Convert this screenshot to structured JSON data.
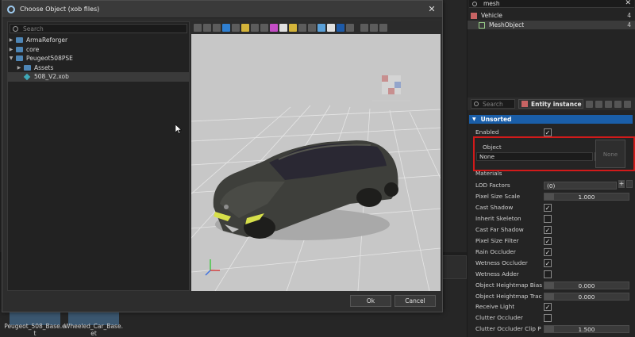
{
  "dialog": {
    "title": "Choose Object (xob files)",
    "search_placeholder": "Search",
    "tree": [
      {
        "label": "ArmaReforger",
        "type": "folder",
        "level": 0,
        "expanded": false
      },
      {
        "label": "core",
        "type": "folder",
        "level": 0,
        "expanded": false
      },
      {
        "label": "Peugeot508PSE",
        "type": "folder",
        "level": 0,
        "expanded": true
      },
      {
        "label": "Assets",
        "type": "folder",
        "level": 1,
        "expanded": false
      },
      {
        "label": "508_V2.xob",
        "type": "xob-file",
        "level": 1,
        "selected": true
      }
    ],
    "ok_label": "Ok",
    "cancel_label": "Cancel"
  },
  "assets": [
    {
      "label_line1": "Peugeot_508_Base.e",
      "label_line2": "t"
    },
    {
      "label_line1": "Wheeled_Car_Base.",
      "label_line2": "et"
    }
  ],
  "hierarchy": {
    "search_value": "mesh",
    "rows": [
      {
        "label": "Vehicle",
        "count": "4"
      },
      {
        "label": "MeshObject",
        "count": "4"
      }
    ]
  },
  "inspector": {
    "search_placeholder": "Search",
    "entity_label": "Entity instance",
    "section": "Unsorted",
    "enabled_label": "Enabled",
    "object_label": "Object",
    "object_value": "None",
    "object_preview": "None",
    "materials_label": "Materials",
    "props": [
      {
        "label": "LOD Factors",
        "kind": "list",
        "value": "(0)"
      },
      {
        "label": "Pixel Size Scale",
        "kind": "number",
        "value": "1.000"
      },
      {
        "label": "Cast Shadow",
        "kind": "check",
        "checked": true
      },
      {
        "label": "Inherit Skeleton",
        "kind": "check",
        "checked": false
      },
      {
        "label": "Cast Far Shadow",
        "kind": "check",
        "checked": true
      },
      {
        "label": "Pixel Size Filter",
        "kind": "check",
        "checked": true
      },
      {
        "label": "Rain Occluder",
        "kind": "check",
        "checked": true
      },
      {
        "label": "Wetness Occluder",
        "kind": "check",
        "checked": true
      },
      {
        "label": "Wetness Adder",
        "kind": "check",
        "checked": false
      },
      {
        "label": "Object Heightmap Bias",
        "kind": "number",
        "value": "0.000"
      },
      {
        "label": "Object Heightmap Trac",
        "kind": "number",
        "value": "0.000"
      },
      {
        "label": "Receive Light",
        "kind": "check",
        "checked": true
      },
      {
        "label": "Clutter Occluder",
        "kind": "check",
        "checked": false
      },
      {
        "label": "Clutter Occluder Clip P",
        "kind": "number",
        "value": "1.500"
      }
    ],
    "check_glyph": "✓"
  }
}
